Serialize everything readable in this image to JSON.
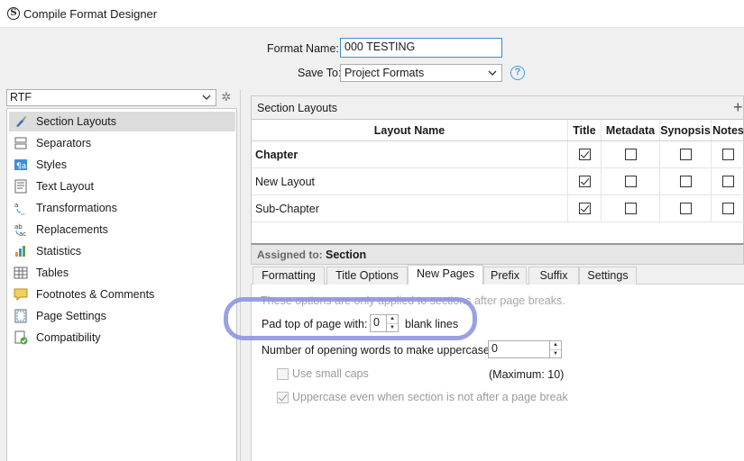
{
  "window": {
    "title": "Compile Format Designer"
  },
  "form": {
    "format_name_label": "Format Name:",
    "format_name_value": "000 TESTING",
    "save_to_label": "Save To:",
    "save_to_value": "Project Formats",
    "help": "?"
  },
  "sidebar": {
    "format_select": "RTF",
    "items": [
      {
        "label": "Section Layouts",
        "icon": "brush-icon",
        "selected": true
      },
      {
        "label": "Separators",
        "icon": "separators-icon"
      },
      {
        "label": "Styles",
        "icon": "styles-icon"
      },
      {
        "label": "Text Layout",
        "icon": "text-layout-icon"
      },
      {
        "label": "Transformations",
        "icon": "transformations-icon"
      },
      {
        "label": "Replacements",
        "icon": "replacements-icon"
      },
      {
        "label": "Statistics",
        "icon": "statistics-icon"
      },
      {
        "label": "Tables",
        "icon": "tables-icon"
      },
      {
        "label": "Footnotes & Comments",
        "icon": "footnotes-icon"
      },
      {
        "label": "Page Settings",
        "icon": "page-settings-icon"
      },
      {
        "label": "Compatibility",
        "icon": "compatibility-icon"
      }
    ]
  },
  "section_layouts": {
    "title": "Section Layouts",
    "add": "+",
    "columns": [
      "Layout Name",
      "Title",
      "Metadata",
      "Synopsis",
      "Notes"
    ],
    "rows": [
      {
        "name": "Chapter",
        "bold": true,
        "title": true,
        "metadata": false,
        "synopsis": false,
        "notes": false
      },
      {
        "name": "New Layout",
        "bold": false,
        "title": true,
        "metadata": false,
        "synopsis": false,
        "notes": false
      },
      {
        "name": "Sub-Chapter",
        "bold": false,
        "title": true,
        "metadata": false,
        "synopsis": false,
        "notes": false
      }
    ],
    "assigned_label": "Assigned to:",
    "assigned_value": "Section"
  },
  "tabs": {
    "items": [
      "Formatting",
      "Title Options",
      "New Pages",
      "Prefix",
      "Suffix",
      "Settings"
    ],
    "active": "New Pages"
  },
  "new_pages": {
    "hint": "These options are only applied to sections after page breaks.",
    "pad_label": "Pad top of page with:",
    "pad_value": "0",
    "pad_suffix": "blank lines",
    "uppercase_label": "Number of opening words to make uppercase:",
    "uppercase_value": "0",
    "small_caps_label": "Use small caps",
    "small_caps_checked": false,
    "maximum_label": "(Maximum: 10)",
    "uppercase_even_label": "Uppercase even when section is not after a page break",
    "uppercase_even_checked": true
  },
  "colors": {
    "highlight": "#8a8fe0",
    "focus_border": "#3c8ad8"
  }
}
